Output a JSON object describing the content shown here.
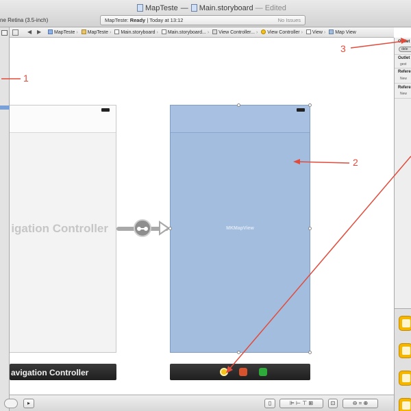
{
  "window": {
    "title_project": "MapTeste",
    "title_separator": "—",
    "title_file": "Main.storyboard",
    "title_edited": "— Edited",
    "device": "ne Retina (3.5-inch)"
  },
  "status": {
    "scheme": "MapTeste:",
    "state": "Ready",
    "time": "Today at 13:12",
    "issues": "No Issues"
  },
  "jumpbar": {
    "crumbs": [
      "MapTeste",
      "MapTeste",
      "Main.storyboard",
      "Main.storyboard...",
      "View Controller...",
      "View Controller",
      "View",
      "Map View"
    ]
  },
  "inspector": {
    "outlets_header": "Outlet",
    "delegate_pill": "dele",
    "outlets2_header": "Outlet",
    "gest": "gest",
    "ref1_header": "Refere",
    "ref1_item": "New",
    "ref2_header": "Refere",
    "ref2_item": "New"
  },
  "scenes": {
    "nav_title": "igation Controller",
    "nav_dock_label": "avigation Controller",
    "map_label": "MKMapView"
  },
  "annotations": {
    "one": "1",
    "two": "2",
    "three": "3",
    "color": "#e14b3b"
  },
  "colors": {
    "map_view": "#a3bddf",
    "dock": "#2b2b2b",
    "library_accent": "#f4b600"
  }
}
